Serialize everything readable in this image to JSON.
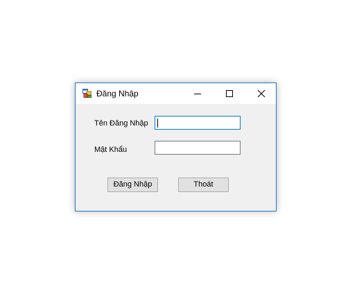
{
  "window": {
    "title": "Đăng Nhập"
  },
  "form": {
    "username_label": "Tên Đăng Nhập",
    "username_value": "",
    "password_label": "Mật Khẩu",
    "password_value": "",
    "login_button_label": "Đăng Nhập",
    "exit_button_label": "Thoát"
  },
  "colors": {
    "accent": "#0078d7",
    "window_border": "#1979ca",
    "form_background": "#f0f0f0",
    "button_background": "#e1e1e1"
  },
  "icons": {
    "app": "app-form-icon",
    "minimize": "minimize-icon",
    "maximize": "maximize-icon",
    "close": "close-icon"
  }
}
